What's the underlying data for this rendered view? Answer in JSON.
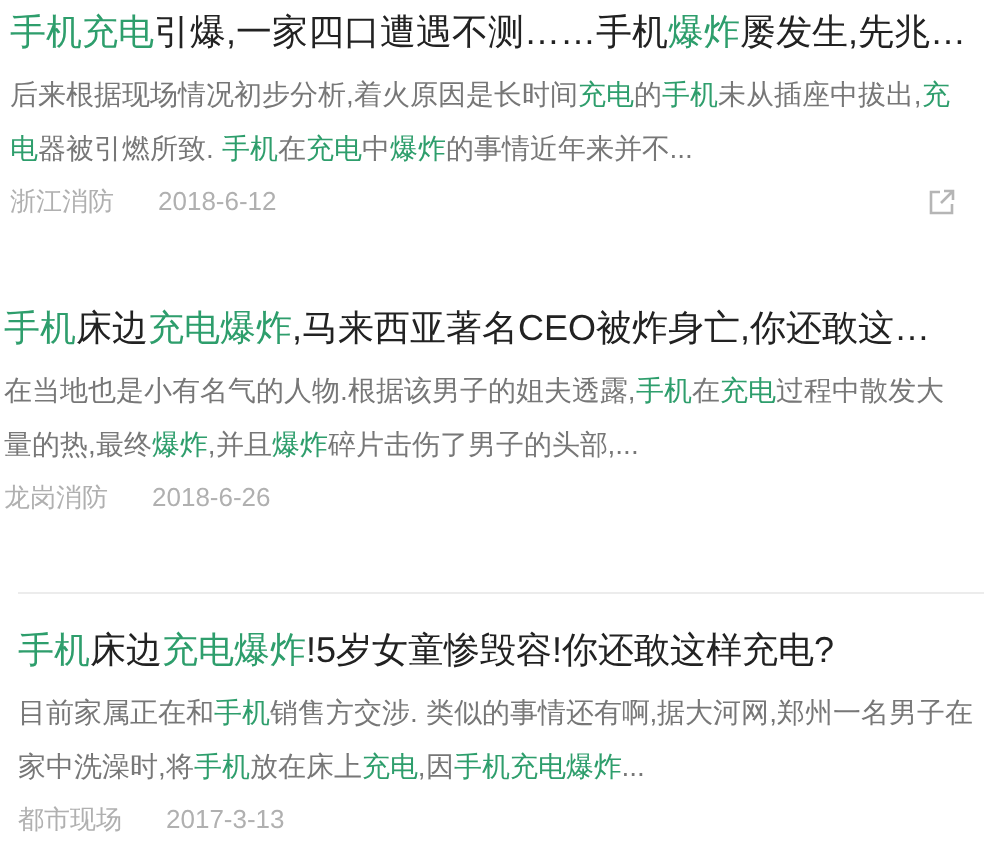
{
  "results": [
    {
      "divider_above": false,
      "share_button": true,
      "title": [
        {
          "text": "手机充电",
          "highlight": true
        },
        {
          "text": "引爆,一家四口遭遇不测……手机",
          "highlight": false
        },
        {
          "text": "爆炸",
          "highlight": true
        },
        {
          "text": "屡发生,先兆…",
          "highlight": false
        }
      ],
      "snippet": [
        [
          {
            "text": "后来根据现场情况初步分析,着火原因是长时间",
            "highlight": false
          },
          {
            "text": "充电",
            "highlight": true
          },
          {
            "text": "的",
            "highlight": false
          },
          {
            "text": "手机",
            "highlight": true
          },
          {
            "text": "未从插座中拔出,",
            "highlight": false
          },
          {
            "text": "充",
            "highlight": true
          }
        ],
        [
          {
            "text": "电",
            "highlight": true
          },
          {
            "text": "器被引燃所致. ",
            "highlight": false
          },
          {
            "text": "手机",
            "highlight": true
          },
          {
            "text": "在",
            "highlight": false
          },
          {
            "text": "充电",
            "highlight": true
          },
          {
            "text": "中",
            "highlight": false
          },
          {
            "text": "爆炸",
            "highlight": true
          },
          {
            "text": "的事情近年来并不...",
            "highlight": false
          }
        ]
      ],
      "source": "浙江消防",
      "date": "2018-6-12"
    },
    {
      "divider_above": false,
      "share_button": false,
      "title": [
        {
          "text": "手机",
          "highlight": true
        },
        {
          "text": "床边",
          "highlight": false
        },
        {
          "text": "充电爆炸",
          "highlight": true
        },
        {
          "text": ",马来西亚著名CEO被炸身亡,你还敢这…",
          "highlight": false
        }
      ],
      "snippet": [
        [
          {
            "text": "在当地也是小有名气的人物.根据该男子的姐夫透露,",
            "highlight": false
          },
          {
            "text": "手机",
            "highlight": true
          },
          {
            "text": "在",
            "highlight": false
          },
          {
            "text": "充电",
            "highlight": true
          },
          {
            "text": "过程中散发大",
            "highlight": false
          }
        ],
        [
          {
            "text": "量的热,最终",
            "highlight": false
          },
          {
            "text": "爆炸",
            "highlight": true
          },
          {
            "text": ",并且",
            "highlight": false
          },
          {
            "text": "爆炸",
            "highlight": true
          },
          {
            "text": "碎片击伤了男子的头部,...",
            "highlight": false
          }
        ]
      ],
      "source": "龙岗消防",
      "date": "2018-6-26"
    },
    {
      "divider_above": true,
      "share_button": false,
      "title": [
        {
          "text": "手机",
          "highlight": true
        },
        {
          "text": "床边",
          "highlight": false
        },
        {
          "text": "充电爆炸",
          "highlight": true
        },
        {
          "text": "!5岁女童惨毁容!你还敢这样充电?",
          "highlight": false
        }
      ],
      "snippet": [
        [
          {
            "text": "目前家属正在和",
            "highlight": false
          },
          {
            "text": "手机",
            "highlight": true
          },
          {
            "text": "销售方交涉. 类似的事情还有啊,据大河网,郑州一名男子在",
            "highlight": false
          }
        ],
        [
          {
            "text": "家中洗澡时,将",
            "highlight": false
          },
          {
            "text": "手机",
            "highlight": true
          },
          {
            "text": "放在床上",
            "highlight": false
          },
          {
            "text": "充电",
            "highlight": true
          },
          {
            "text": ",因",
            "highlight": false
          },
          {
            "text": "手机充电爆炸",
            "highlight": true
          },
          {
            "text": "...",
            "highlight": false
          }
        ]
      ],
      "source": "都市现场",
      "date": "2017-3-13"
    }
  ]
}
